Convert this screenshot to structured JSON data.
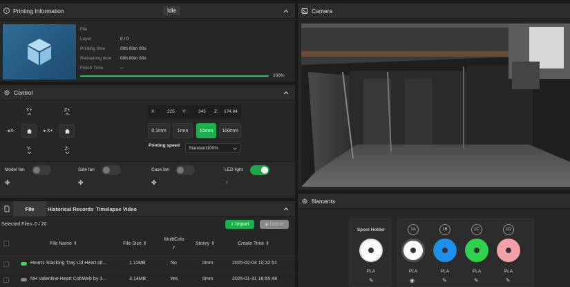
{
  "printing": {
    "title": "Printing Information",
    "status": "Idle",
    "labels": {
      "file": "File",
      "layer": "Layer",
      "printing_time": "Printing time",
      "remaining_time": "Remaining time",
      "finish_time": "Finish Time"
    },
    "values": {
      "file": "",
      "layer": "0 / 0",
      "printing_time": "00h 00m 00s",
      "remaining_time": "00h 00m 00s",
      "finish_time": "--"
    },
    "progress": 100,
    "progress_label": "100%"
  },
  "camera": {
    "title": "Camera"
  },
  "control": {
    "title": "Control",
    "jog": {
      "y_plus": "Y+",
      "y_minus": "Y-",
      "x_minus": "X-",
      "x_plus": "X+",
      "z_plus": "Z+",
      "z_minus": "Z-"
    },
    "coords": {
      "x_label": "X:",
      "x_val": "225",
      "y_label": "Y:",
      "y_val": "345",
      "z_label": "Z:",
      "z_val": "174.84"
    },
    "steps": [
      "0.1mm",
      "1mm",
      "10mm",
      "100mm"
    ],
    "active_step": "10mm",
    "speed_label": "Printing speed",
    "speed_value": "Standard100%",
    "fans": {
      "model": "Model fan",
      "side": "Side fan",
      "case": "Case fan",
      "led": "LED light"
    }
  },
  "files": {
    "tabs": {
      "file": "File",
      "history": "Historical Records",
      "timelapse": "Timelapse Video"
    },
    "selected": "Selected Files: 0 / 20",
    "import_label": "Import",
    "delete_label": "Delete",
    "headers": {
      "name": "File Name",
      "size": "File Size",
      "multicolor": "MultiColo r",
      "storey": "Storey",
      "create": "Create Time"
    },
    "rows": [
      {
        "name": "Hearts Stacking Tray Lid Heart.stl...",
        "size": "1.11MB",
        "multicolor": "No",
        "storey": "0mm",
        "created": "2025-02-03 10:32:51",
        "color": "#3ddc5a"
      },
      {
        "name": "NH Valentine Heart CobWeb by 3...",
        "size": "3.14MB",
        "multicolor": "Yes",
        "storey": "0mm",
        "created": "2025-01-31 16:55:48",
        "color": "#888888"
      }
    ]
  },
  "filaments": {
    "title": "filaments",
    "spool_holder": "Spool Holder",
    "slots": [
      {
        "id": "spool",
        "label": "PLA",
        "color": "#ffffff",
        "ring": "#dddddd"
      },
      {
        "id": "1A",
        "label": "PLA",
        "color": "#ffffff",
        "ring": "#555555"
      },
      {
        "id": "1B",
        "label": "PLA",
        "color": "#1e90e8",
        "ring": "#1e90e8"
      },
      {
        "id": "1C",
        "label": "PLA",
        "color": "#2ed14e",
        "ring": "#2ed14e"
      },
      {
        "id": "1D",
        "label": "PLA",
        "color": "#f4a0a8",
        "ring": "#f4a0a8"
      }
    ]
  }
}
